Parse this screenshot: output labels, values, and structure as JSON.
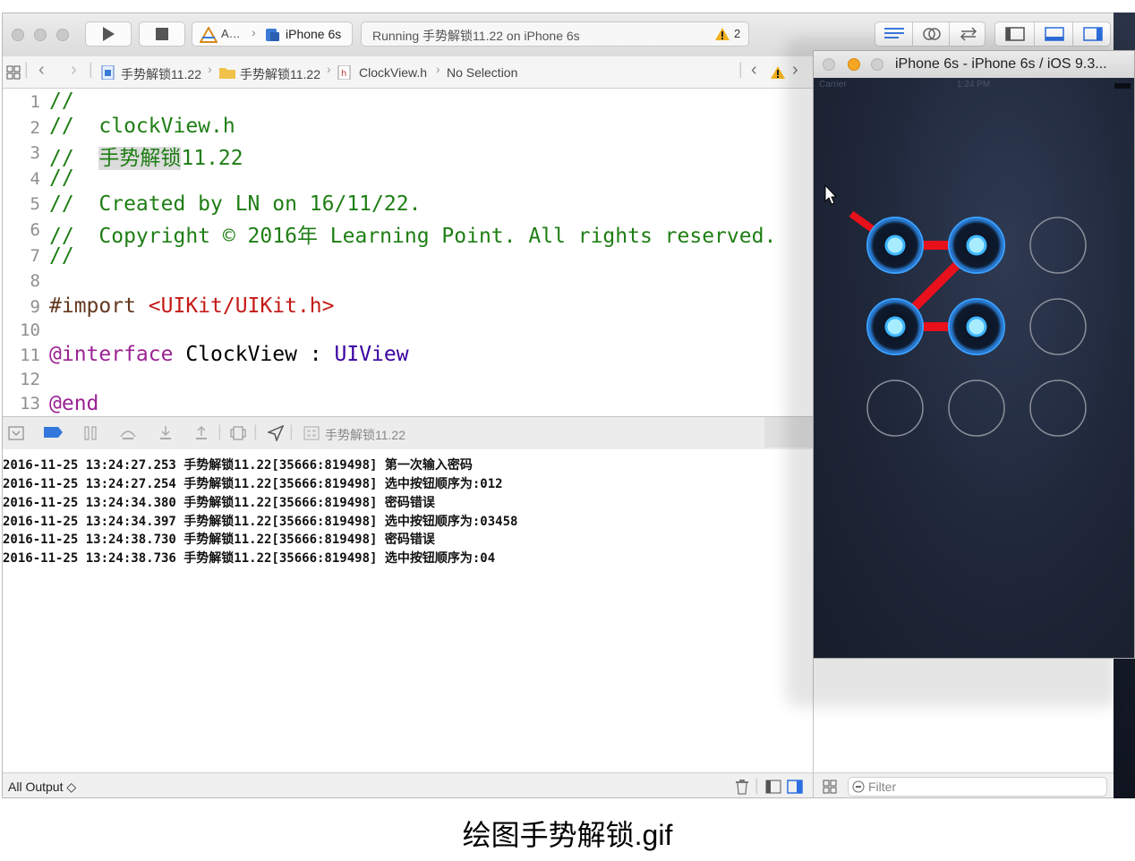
{
  "toolbar": {
    "scheme_app": "A…",
    "scheme_device": "iPhone 6s",
    "activity_text": "Running 手势解锁11.22 on iPhone 6s",
    "warning_count": "2"
  },
  "jumpbar": {
    "project": "手势解锁11.22",
    "folder": "手势解锁11.22",
    "file": "ClockView.h",
    "selection": "No Selection"
  },
  "editor": {
    "line_numbers": [
      "1",
      "2",
      "3",
      "4",
      "5",
      "6",
      "7",
      "8",
      "9",
      "10",
      "11",
      "12",
      "13"
    ],
    "l1": "//",
    "l2": "//  clockView.h",
    "l3_prefix": "//  ",
    "l3_highlight": "手势解锁",
    "l3_rest": "11.22",
    "l4": "//",
    "l5": "//  Created by LN on 16/11/22.",
    "l6": "//  Copyright © 2016年 Learning Point. All rights reserved.",
    "l7": "//",
    "l9_directive": "#import ",
    "l9_path": "<UIKit/UIKit.h>",
    "l11_keyword": "@interface",
    "l11_class": " ClockView : ",
    "l11_super": "UIView",
    "l13": "@end"
  },
  "debugbar": {
    "target": "手势解锁11.22"
  },
  "console": {
    "lines": [
      "2016-11-25 13:24:27.253 手势解锁11.22[35666:819498] 第一次输入密码",
      "2016-11-25 13:24:27.254 手势解锁11.22[35666:819498] 选中按钮顺序为:012",
      "2016-11-25 13:24:34.380 手势解锁11.22[35666:819498] 密码错误",
      "2016-11-25 13:24:34.397 手势解锁11.22[35666:819498] 选中按钮顺序为:03458",
      "2016-11-25 13:24:38.730 手势解锁11.22[35666:819498] 密码错误",
      "2016-11-25 13:24:38.736 手势解锁11.22[35666:819498] 选中按钮顺序为:04"
    ],
    "output_selector": "All Output ◇"
  },
  "variables": {
    "filter_placeholder": "Filter"
  },
  "simulator": {
    "title": "iPhone 6s - iPhone 6s / iOS 9.3...",
    "status_carrier": "Carrier",
    "status_time": "1:24 PM",
    "selected_buttons": [
      0,
      1,
      3,
      4
    ]
  },
  "caption": "绘图手势解锁.gif",
  "colors": {
    "comment": "#1e7e14",
    "keyword": "#9b2393",
    "string": "#c41a16",
    "type": "#3900a0",
    "gesture_line": "#e8101a",
    "node_glow": "#3aa0ff"
  }
}
